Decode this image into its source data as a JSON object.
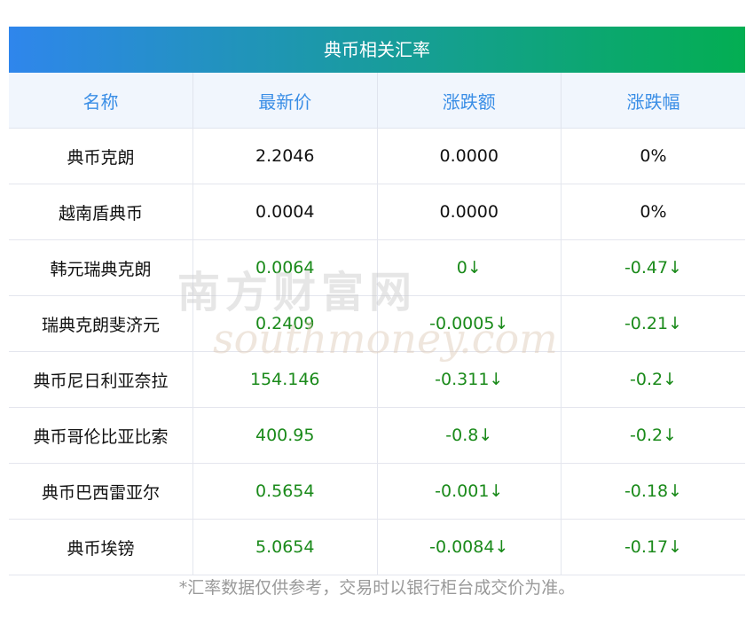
{
  "title": "典币相关汇率",
  "headers": [
    "名称",
    "最新价",
    "涨跌额",
    "涨跌幅"
  ],
  "rows": [
    {
      "name": "典币克朗",
      "price": "2.2046",
      "change": "0.0000",
      "pct": "0%",
      "down": false
    },
    {
      "name": "越南盾典币",
      "price": "0.0004",
      "change": "0.0000",
      "pct": "0%",
      "down": false
    },
    {
      "name": "韩元瑞典克朗",
      "price": "0.0064",
      "change": "0↓",
      "pct": "-0.47↓",
      "down": true
    },
    {
      "name": "瑞典克朗斐济元",
      "price": "0.2409",
      "change": "-0.0005↓",
      "pct": "-0.21↓",
      "down": true
    },
    {
      "name": "典币尼日利亚奈拉",
      "price": "154.146",
      "change": "-0.311↓",
      "pct": "-0.2↓",
      "down": true
    },
    {
      "name": "典币哥伦比亚比索",
      "price": "400.95",
      "change": "-0.8↓",
      "pct": "-0.2↓",
      "down": true
    },
    {
      "name": "典币巴西雷亚尔",
      "price": "0.5654",
      "change": "-0.001↓",
      "pct": "-0.18↓",
      "down": true
    },
    {
      "name": "典币埃镑",
      "price": "5.0654",
      "change": "-0.0084↓",
      "pct": "-0.17↓",
      "down": true
    }
  ],
  "watermark": {
    "cn": "南方财富网",
    "en": "southmoney.com"
  },
  "note": "*汇率数据仅供参考，交易时以银行柜台成交价为准。",
  "colors": {
    "down": "#1a8a1a",
    "header_text": "#3a8ee6"
  }
}
